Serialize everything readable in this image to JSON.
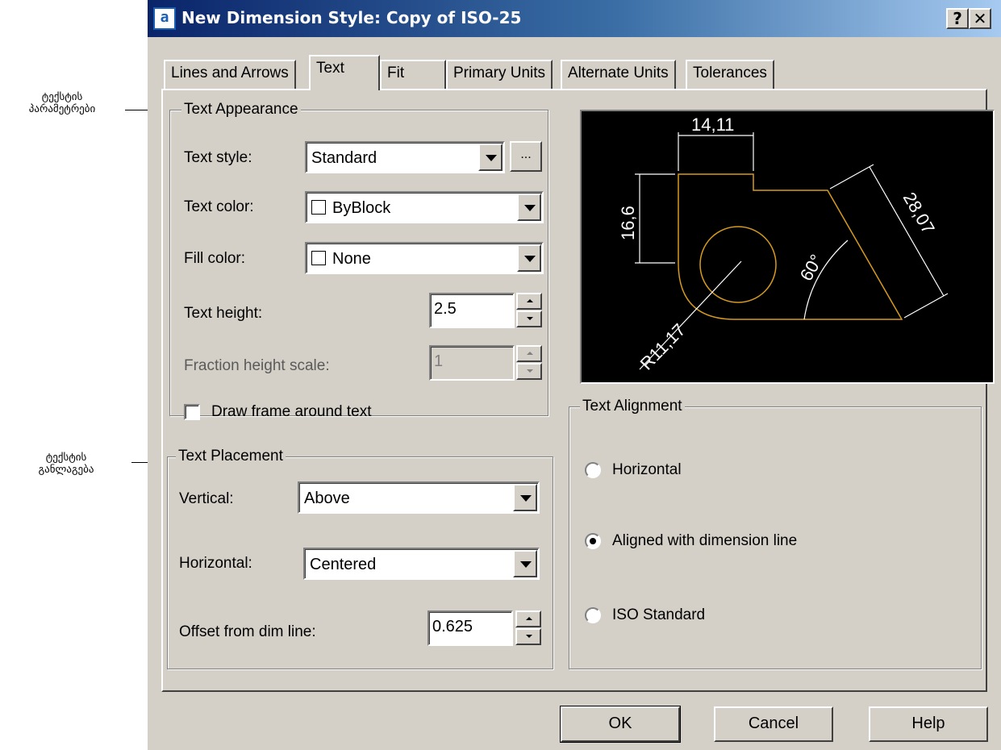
{
  "annotations": {
    "top": [
      "ტექსტის",
      "პარამეტრები"
    ],
    "bottom": [
      "ტექსტის",
      "განლაგება"
    ]
  },
  "window": {
    "title": "New Dimension Style: Copy of ISO-25",
    "help_btn": "?",
    "close_btn": "✕"
  },
  "tabs": [
    {
      "label": "Lines and Arrows"
    },
    {
      "label": "Text"
    },
    {
      "label": "Fit"
    },
    {
      "label": "Primary Units"
    },
    {
      "label": "Alternate Units"
    },
    {
      "label": "Tolerances"
    }
  ],
  "text_appearance": {
    "title": "Text Appearance",
    "style_label": "Text style:",
    "style_value": "Standard",
    "browse_label": "...",
    "color_label": "Text color:",
    "color_value": "ByBlock",
    "fill_label": "Fill color:",
    "fill_value": "None",
    "height_label": "Text height:",
    "height_value": "2.5",
    "fraction_label": "Fraction height scale:",
    "fraction_value": "1",
    "frame_label": "Draw frame around text",
    "frame_checked": false
  },
  "text_placement": {
    "title": "Text Placement",
    "vertical_label": "Vertical:",
    "vertical_value": "Above",
    "horizontal_label": "Horizontal:",
    "horizontal_value": "Centered",
    "offset_label": "Offset from dim line:",
    "offset_value": "0.625"
  },
  "preview": {
    "dim_top": "14,11",
    "dim_left": "16,6",
    "dim_slant": "28,07",
    "dim_angle": "60°",
    "dim_radius": "R11,17",
    "geometry_color": "#d79a1e",
    "dimension_color": "#ffffff"
  },
  "text_alignment": {
    "title": "Text Alignment",
    "options": [
      {
        "label": "Horizontal",
        "checked": false
      },
      {
        "label": "Aligned with dimension line",
        "checked": true
      },
      {
        "label": "ISO Standard",
        "checked": false
      }
    ]
  },
  "buttons": {
    "ok": "OK",
    "cancel": "Cancel",
    "help": "Help"
  }
}
